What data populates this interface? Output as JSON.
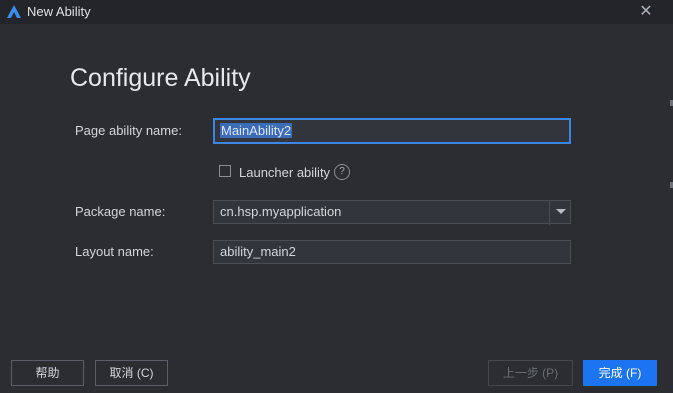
{
  "window": {
    "title": "New Ability"
  },
  "header": {
    "title": "Configure Ability"
  },
  "form": {
    "page_ability_label": "Page ability name:",
    "page_ability_value": "MainAbility2",
    "launcher_label": "Launcher ability",
    "launcher_checked": false,
    "package_label": "Package name:",
    "package_value": "cn.hsp.myapplication",
    "layout_label": "Layout name:",
    "layout_value": "ability_main2"
  },
  "footer": {
    "help_label": "帮助",
    "cancel_label": "取消 (C)",
    "prev_label": "上一步 (P)",
    "finish_label": "完成 (F)"
  },
  "icons": {
    "app": "app-logo-icon",
    "close": "close-icon",
    "help": "question-mark-icon",
    "dropdown": "chevron-down-icon"
  },
  "colors": {
    "background": "#2b2d30",
    "accent": "#1d74f0",
    "focus_border": "#3d86e5"
  }
}
